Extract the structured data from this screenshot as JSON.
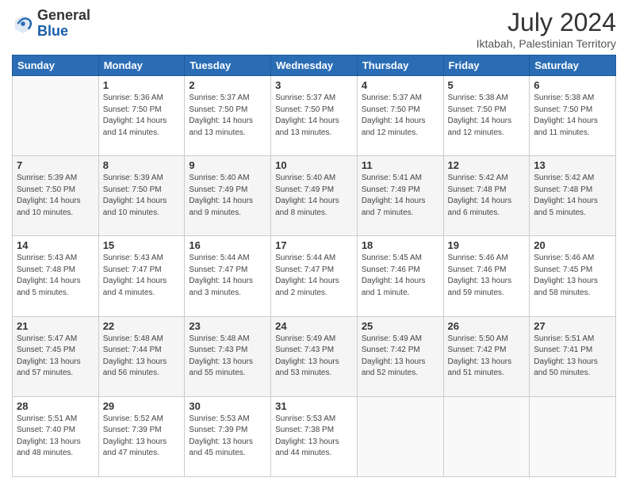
{
  "logo": {
    "general": "General",
    "blue": "Blue"
  },
  "header": {
    "month": "July 2024",
    "location": "Iktabah, Palestinian Territory"
  },
  "weekdays": [
    "Sunday",
    "Monday",
    "Tuesday",
    "Wednesday",
    "Thursday",
    "Friday",
    "Saturday"
  ],
  "weeks": [
    [
      {
        "day": "",
        "sunrise": "",
        "sunset": "",
        "daylight": ""
      },
      {
        "day": "1",
        "sunrise": "Sunrise: 5:36 AM",
        "sunset": "Sunset: 7:50 PM",
        "daylight": "Daylight: 14 hours and 14 minutes."
      },
      {
        "day": "2",
        "sunrise": "Sunrise: 5:37 AM",
        "sunset": "Sunset: 7:50 PM",
        "daylight": "Daylight: 14 hours and 13 minutes."
      },
      {
        "day": "3",
        "sunrise": "Sunrise: 5:37 AM",
        "sunset": "Sunset: 7:50 PM",
        "daylight": "Daylight: 14 hours and 13 minutes."
      },
      {
        "day": "4",
        "sunrise": "Sunrise: 5:37 AM",
        "sunset": "Sunset: 7:50 PM",
        "daylight": "Daylight: 14 hours and 12 minutes."
      },
      {
        "day": "5",
        "sunrise": "Sunrise: 5:38 AM",
        "sunset": "Sunset: 7:50 PM",
        "daylight": "Daylight: 14 hours and 12 minutes."
      },
      {
        "day": "6",
        "sunrise": "Sunrise: 5:38 AM",
        "sunset": "Sunset: 7:50 PM",
        "daylight": "Daylight: 14 hours and 11 minutes."
      }
    ],
    [
      {
        "day": "7",
        "sunrise": "Sunrise: 5:39 AM",
        "sunset": "Sunset: 7:50 PM",
        "daylight": "Daylight: 14 hours and 10 minutes."
      },
      {
        "day": "8",
        "sunrise": "Sunrise: 5:39 AM",
        "sunset": "Sunset: 7:50 PM",
        "daylight": "Daylight: 14 hours and 10 minutes."
      },
      {
        "day": "9",
        "sunrise": "Sunrise: 5:40 AM",
        "sunset": "Sunset: 7:49 PM",
        "daylight": "Daylight: 14 hours and 9 minutes."
      },
      {
        "day": "10",
        "sunrise": "Sunrise: 5:40 AM",
        "sunset": "Sunset: 7:49 PM",
        "daylight": "Daylight: 14 hours and 8 minutes."
      },
      {
        "day": "11",
        "sunrise": "Sunrise: 5:41 AM",
        "sunset": "Sunset: 7:49 PM",
        "daylight": "Daylight: 14 hours and 7 minutes."
      },
      {
        "day": "12",
        "sunrise": "Sunrise: 5:42 AM",
        "sunset": "Sunset: 7:48 PM",
        "daylight": "Daylight: 14 hours and 6 minutes."
      },
      {
        "day": "13",
        "sunrise": "Sunrise: 5:42 AM",
        "sunset": "Sunset: 7:48 PM",
        "daylight": "Daylight: 14 hours and 5 minutes."
      }
    ],
    [
      {
        "day": "14",
        "sunrise": "Sunrise: 5:43 AM",
        "sunset": "Sunset: 7:48 PM",
        "daylight": "Daylight: 14 hours and 5 minutes."
      },
      {
        "day": "15",
        "sunrise": "Sunrise: 5:43 AM",
        "sunset": "Sunset: 7:47 PM",
        "daylight": "Daylight: 14 hours and 4 minutes."
      },
      {
        "day": "16",
        "sunrise": "Sunrise: 5:44 AM",
        "sunset": "Sunset: 7:47 PM",
        "daylight": "Daylight: 14 hours and 3 minutes."
      },
      {
        "day": "17",
        "sunrise": "Sunrise: 5:44 AM",
        "sunset": "Sunset: 7:47 PM",
        "daylight": "Daylight: 14 hours and 2 minutes."
      },
      {
        "day": "18",
        "sunrise": "Sunrise: 5:45 AM",
        "sunset": "Sunset: 7:46 PM",
        "daylight": "Daylight: 14 hours and 1 minute."
      },
      {
        "day": "19",
        "sunrise": "Sunrise: 5:46 AM",
        "sunset": "Sunset: 7:46 PM",
        "daylight": "Daylight: 13 hours and 59 minutes."
      },
      {
        "day": "20",
        "sunrise": "Sunrise: 5:46 AM",
        "sunset": "Sunset: 7:45 PM",
        "daylight": "Daylight: 13 hours and 58 minutes."
      }
    ],
    [
      {
        "day": "21",
        "sunrise": "Sunrise: 5:47 AM",
        "sunset": "Sunset: 7:45 PM",
        "daylight": "Daylight: 13 hours and 57 minutes."
      },
      {
        "day": "22",
        "sunrise": "Sunrise: 5:48 AM",
        "sunset": "Sunset: 7:44 PM",
        "daylight": "Daylight: 13 hours and 56 minutes."
      },
      {
        "day": "23",
        "sunrise": "Sunrise: 5:48 AM",
        "sunset": "Sunset: 7:43 PM",
        "daylight": "Daylight: 13 hours and 55 minutes."
      },
      {
        "day": "24",
        "sunrise": "Sunrise: 5:49 AM",
        "sunset": "Sunset: 7:43 PM",
        "daylight": "Daylight: 13 hours and 53 minutes."
      },
      {
        "day": "25",
        "sunrise": "Sunrise: 5:49 AM",
        "sunset": "Sunset: 7:42 PM",
        "daylight": "Daylight: 13 hours and 52 minutes."
      },
      {
        "day": "26",
        "sunrise": "Sunrise: 5:50 AM",
        "sunset": "Sunset: 7:42 PM",
        "daylight": "Daylight: 13 hours and 51 minutes."
      },
      {
        "day": "27",
        "sunrise": "Sunrise: 5:51 AM",
        "sunset": "Sunset: 7:41 PM",
        "daylight": "Daylight: 13 hours and 50 minutes."
      }
    ],
    [
      {
        "day": "28",
        "sunrise": "Sunrise: 5:51 AM",
        "sunset": "Sunset: 7:40 PM",
        "daylight": "Daylight: 13 hours and 48 minutes."
      },
      {
        "day": "29",
        "sunrise": "Sunrise: 5:52 AM",
        "sunset": "Sunset: 7:39 PM",
        "daylight": "Daylight: 13 hours and 47 minutes."
      },
      {
        "day": "30",
        "sunrise": "Sunrise: 5:53 AM",
        "sunset": "Sunset: 7:39 PM",
        "daylight": "Daylight: 13 hours and 45 minutes."
      },
      {
        "day": "31",
        "sunrise": "Sunrise: 5:53 AM",
        "sunset": "Sunset: 7:38 PM",
        "daylight": "Daylight: 13 hours and 44 minutes."
      },
      {
        "day": "",
        "sunrise": "",
        "sunset": "",
        "daylight": ""
      },
      {
        "day": "",
        "sunrise": "",
        "sunset": "",
        "daylight": ""
      },
      {
        "day": "",
        "sunrise": "",
        "sunset": "",
        "daylight": ""
      }
    ]
  ]
}
